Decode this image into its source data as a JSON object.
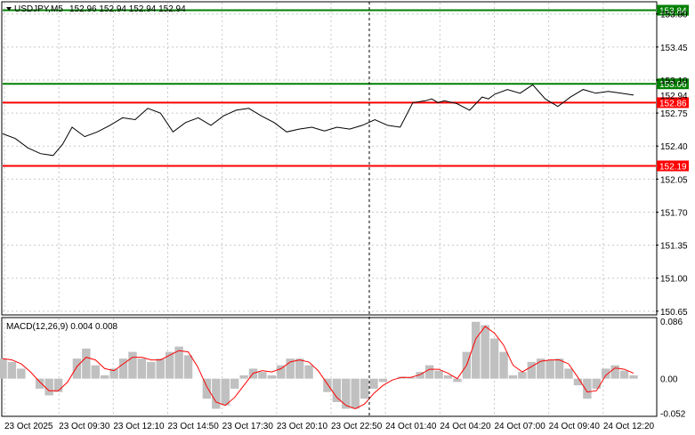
{
  "header": {
    "symbol_label": "USDJPY,M5",
    "ohlc": "152.96 152.94 152.94 152.94"
  },
  "macd": {
    "title": "MACD(12,26,9) 0.004 0.008"
  },
  "colors": {
    "price_line": "#000000",
    "support_line": "#ff0000",
    "resistance_line": "#008000",
    "histogram": "#c0c0c0",
    "signal_line": "#ff0000",
    "grid": "#c8c8c8"
  },
  "chart_data": [
    {
      "type": "line",
      "title": "USDJPY,M5",
      "x": [
        "23 Oct 2025",
        "23 Oct 09:30",
        "23 Oct 12:10",
        "23 Oct 14:50",
        "23 Oct 17:30",
        "23 Oct 20:10",
        "23 Oct 22:50",
        "24 Oct 01:40",
        "24 Oct 04:20",
        "24 Oct 07:00",
        "24 Oct 09:40",
        "24 Oct 12:20"
      ],
      "y_ticks": [
        "153.80",
        "153.45",
        "153.10",
        "152.75",
        "152.40",
        "152.05",
        "151.70",
        "151.35",
        "151.00",
        "150.65"
      ],
      "ylim": [
        150.62,
        153.92
      ],
      "series": [
        {
          "values_x": [
            0,
            0.02,
            0.04,
            0.06,
            0.08,
            0.095,
            0.11,
            0.13,
            0.15,
            0.17,
            0.19,
            0.21,
            0.23,
            0.25,
            0.27,
            0.29,
            0.31,
            0.33,
            0.35,
            0.37,
            0.39,
            0.41,
            0.43,
            0.45,
            0.47,
            0.49,
            0.51,
            0.53,
            0.55,
            0.57,
            0.59,
            0.61,
            0.63,
            0.65,
            0.67,
            0.68,
            0.69,
            0.7,
            0.72,
            0.74,
            0.76,
            0.77,
            0.78,
            0.8,
            0.82,
            0.84,
            0.86,
            0.88,
            0.9,
            0.92,
            0.94,
            0.96,
            0.98,
            1.0
          ],
          "values": [
            152.53,
            152.48,
            152.38,
            152.32,
            152.3,
            152.42,
            152.6,
            152.5,
            152.55,
            152.62,
            152.7,
            152.68,
            152.8,
            152.75,
            152.55,
            152.65,
            152.7,
            152.62,
            152.72,
            152.78,
            152.8,
            152.72,
            152.65,
            152.55,
            152.58,
            152.6,
            152.56,
            152.6,
            152.58,
            152.62,
            152.68,
            152.62,
            152.6,
            152.86,
            152.88,
            152.9,
            152.86,
            152.88,
            152.85,
            152.78,
            152.92,
            152.9,
            152.95,
            153.0,
            152.96,
            153.05,
            152.9,
            152.82,
            152.92,
            153.0,
            152.96,
            152.98,
            152.96,
            152.94
          ]
        }
      ],
      "levels": [
        {
          "label": "153.84",
          "value": 153.84,
          "kind": "resistance"
        },
        {
          "label": "153.06",
          "value": 153.06,
          "kind": "resistance"
        },
        {
          "label": "152.86",
          "value": 152.86,
          "kind": "support"
        },
        {
          "label": "152.19",
          "value": 152.19,
          "kind": "support"
        }
      ],
      "current_price_label": "152.94"
    },
    {
      "type": "bar",
      "title": "MACD(12,26,9) 0.004 0.008",
      "y_ticks": [
        "0.086",
        "0.00",
        "-0.052"
      ],
      "ylim": [
        -0.055,
        0.09
      ],
      "histogram": [
        0.03,
        0.025,
        0.015,
        0.0,
        -0.015,
        -0.025,
        -0.02,
        0.0,
        0.03,
        0.045,
        0.02,
        0.005,
        0.015,
        0.03,
        0.04,
        0.03,
        0.025,
        0.03,
        0.04,
        0.048,
        0.035,
        0.0,
        -0.03,
        -0.045,
        -0.04,
        -0.015,
        0.005,
        0.015,
        0.01,
        0.005,
        0.02,
        0.03,
        0.03,
        0.02,
        0.0,
        -0.02,
        -0.035,
        -0.045,
        -0.045,
        -0.03,
        -0.015,
        -0.005,
        0.0,
        0.003,
        0.002,
        0.01,
        0.02,
        0.012,
        0.005,
        -0.005,
        0.04,
        0.085,
        0.08,
        0.06,
        0.04,
        0.005,
        0.01,
        0.025,
        0.03,
        0.028,
        0.03,
        0.015,
        -0.01,
        -0.03,
        -0.015,
        0.015,
        0.02,
        0.012,
        0.005
      ],
      "signal": [
        0.03,
        0.028,
        0.022,
        0.01,
        -0.005,
        -0.018,
        -0.018,
        -0.005,
        0.018,
        0.032,
        0.028,
        0.015,
        0.012,
        0.022,
        0.032,
        0.032,
        0.028,
        0.028,
        0.035,
        0.042,
        0.04,
        0.018,
        -0.012,
        -0.035,
        -0.04,
        -0.028,
        -0.01,
        0.008,
        0.012,
        0.01,
        0.015,
        0.025,
        0.028,
        0.025,
        0.012,
        -0.008,
        -0.028,
        -0.04,
        -0.045,
        -0.038,
        -0.022,
        -0.01,
        -0.002,
        0.002,
        0.002,
        0.006,
        0.014,
        0.014,
        0.008,
        0.0,
        0.02,
        0.06,
        0.078,
        0.068,
        0.05,
        0.02,
        0.01,
        0.018,
        0.026,
        0.028,
        0.028,
        0.022,
        0.002,
        -0.02,
        -0.018,
        0.005,
        0.016,
        0.014,
        0.008
      ]
    }
  ]
}
